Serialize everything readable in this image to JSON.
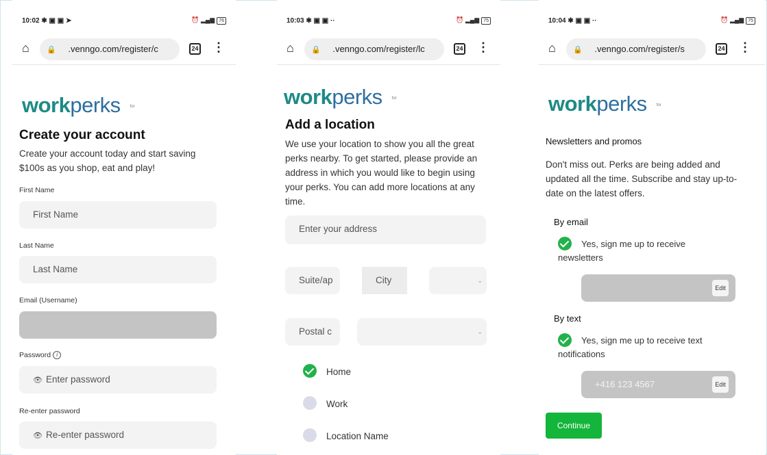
{
  "screens": [
    {
      "status": {
        "time": "10:02",
        "icons": "✱ ▣ ▣ ➤",
        "right": "⏰ ▂▄▆",
        "battery": "76"
      },
      "url": ".venngo.com/register/c",
      "tab_count": "24",
      "logo": {
        "bold": "work",
        "regular": "perks",
        "suffix": "for"
      },
      "title": "Create your account",
      "description": "Create your account today and start saving $100s as you shop, eat and play!",
      "fields": [
        {
          "label": "First Name",
          "placeholder": "First Name"
        },
        {
          "label": "Last Name",
          "placeholder": "Last Name"
        },
        {
          "label": "Email (Username)",
          "placeholder": ""
        },
        {
          "label": "Password",
          "placeholder": "Enter password"
        },
        {
          "label": "Re-enter password",
          "placeholder": "Re-enter password"
        }
      ]
    },
    {
      "status": {
        "time": "10:03",
        "icons": "✱ ▣ ▣ ··",
        "right": "⏰ ▂▄▆",
        "battery": "75"
      },
      "url": ".venngo.com/register/lc",
      "tab_count": "24",
      "logo": {
        "bold": "work",
        "regular": "perks",
        "suffix": "for"
      },
      "title": "Add a location",
      "description": "We use your location to show you all the great perks nearby. To get started, please provide an address in which you would like to begin using your perks. You can add more locations at any time.",
      "address_placeholder": "Enter your address",
      "suite_placeholder": "Suite/ap",
      "city_placeholder": "City",
      "postal_placeholder": "Postal c",
      "location_types": [
        {
          "label": "Home",
          "selected": true
        },
        {
          "label": "Work",
          "selected": false
        },
        {
          "label": "Location Name",
          "selected": false
        }
      ]
    },
    {
      "status": {
        "time": "10:04",
        "icons": "✱ ▣ ▣ ··",
        "right": "⏰ ▂▄▆",
        "battery": "75"
      },
      "url": ".venngo.com/register/s",
      "tab_count": "24",
      "logo": {
        "bold": "work",
        "regular": "perks",
        "suffix": "for"
      },
      "section_title": "Newsletters and promos",
      "description": "Don't miss out. Perks are being added and updated all the time. Subscribe and stay up-to-date on the latest offers.",
      "by_email": {
        "heading": "By email",
        "checkbox_label": "Yes, sign me up to receive newsletters",
        "value": "",
        "edit_label": "Edit"
      },
      "by_text": {
        "heading": "By text",
        "checkbox_label": "Yes, sign me up to receive text notifications",
        "value": "+416 123 4567",
        "edit_label": "Edit"
      },
      "continue_label": "Continue"
    }
  ],
  "colors": {
    "brand_teal": "#1f8a86",
    "brand_blue": "#2d6fa0",
    "success_green": "#22b24c",
    "continue_green": "#13b53b"
  }
}
